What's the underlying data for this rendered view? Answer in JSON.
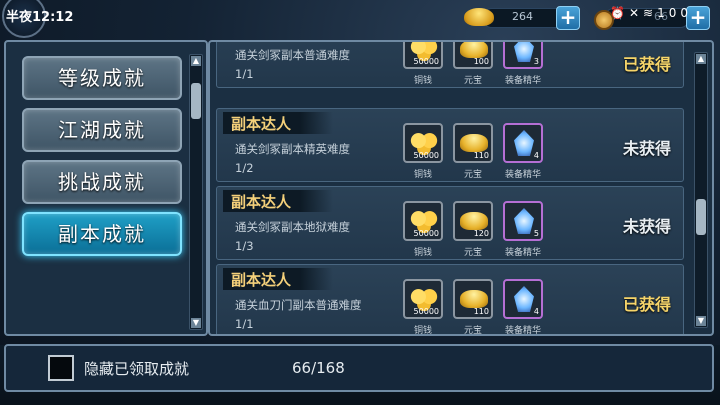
{
  "status_bar": {
    "time": "半夜12:12",
    "ingot_count": "264",
    "coin_count": "66",
    "battery": "100"
  },
  "sidebar": {
    "items": [
      {
        "label": "等级成就",
        "active": false
      },
      {
        "label": "江湖成就",
        "active": false
      },
      {
        "label": "挑战成就",
        "active": false
      },
      {
        "label": "副本成就",
        "active": true
      }
    ]
  },
  "achievements": [
    {
      "title": "",
      "desc": "通关剑冢副本普通难度",
      "progress": "1/1",
      "status": "已获得",
      "rewards": [
        {
          "qty": "50000",
          "label": "铜钱"
        },
        {
          "qty": "100",
          "label": "元宝"
        },
        {
          "qty": "3",
          "label": "装备精华"
        }
      ]
    },
    {
      "title": "副本达人",
      "desc": "通关剑冢副本精英难度",
      "progress": "1/2",
      "status": "未获得",
      "rewards": [
        {
          "qty": "50000",
          "label": "铜钱"
        },
        {
          "qty": "110",
          "label": "元宝"
        },
        {
          "qty": "4",
          "label": "装备精华"
        }
      ]
    },
    {
      "title": "副本达人",
      "desc": "通关剑冢副本地狱难度",
      "progress": "1/3",
      "status": "未获得",
      "rewards": [
        {
          "qty": "50000",
          "label": "铜钱"
        },
        {
          "qty": "120",
          "label": "元宝"
        },
        {
          "qty": "5",
          "label": "装备精华"
        }
      ]
    },
    {
      "title": "副本达人",
      "desc": "通关血刀门副本普通难度",
      "progress": "1/1",
      "status": "已获得",
      "rewards": [
        {
          "qty": "50000",
          "label": "铜钱"
        },
        {
          "qty": "110",
          "label": "元宝"
        },
        {
          "qty": "4",
          "label": "装备精华"
        }
      ]
    }
  ],
  "footer": {
    "hide_label": "隐藏已领取成就",
    "count": "66/168"
  }
}
